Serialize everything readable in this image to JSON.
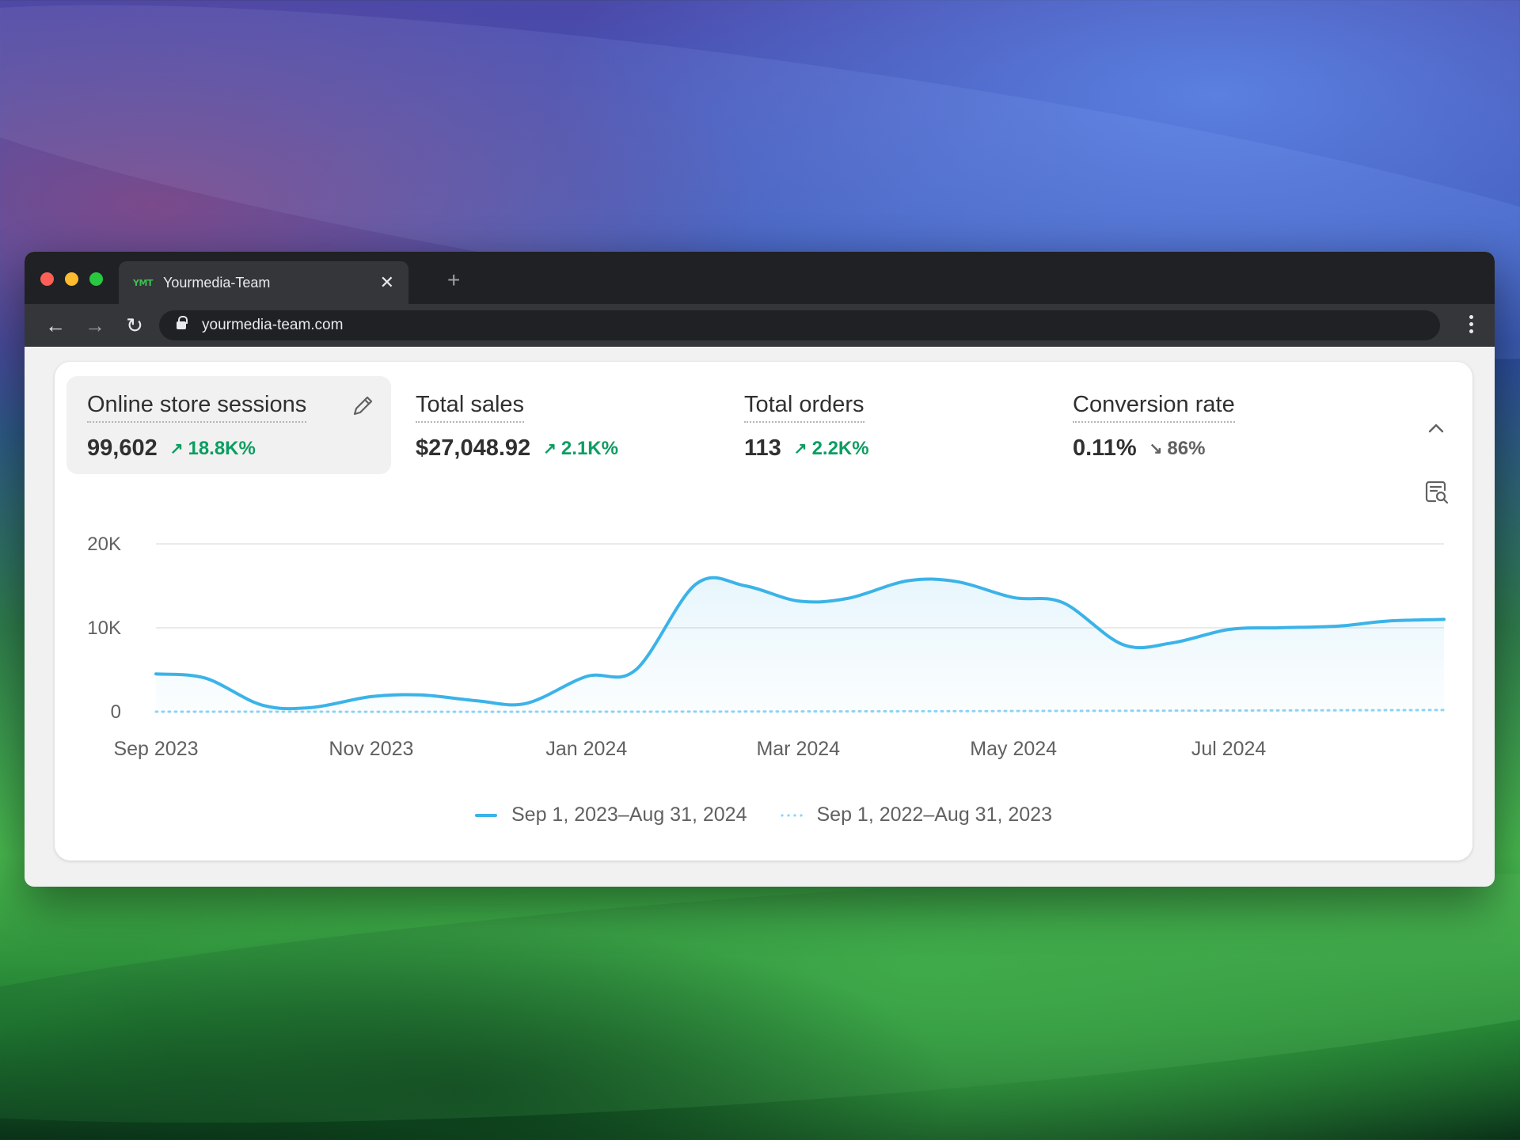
{
  "browser": {
    "tab": {
      "favicon_text": "YMT",
      "title": "Yourmedia-Team"
    },
    "url": "yourmedia-team.com"
  },
  "metrics": [
    {
      "label": "Online store sessions",
      "value": "99,602",
      "change": "18.8K%",
      "direction": "up"
    },
    {
      "label": "Total sales",
      "value": "$27,048.92",
      "change": "2.1K%",
      "direction": "up"
    },
    {
      "label": "Total orders",
      "value": "113",
      "change": "2.2K%",
      "direction": "up"
    },
    {
      "label": "Conversion rate",
      "value": "0.11%",
      "change": "86%",
      "direction": "down"
    }
  ],
  "colors": {
    "accent": "#3bb3e8",
    "positive": "#0c9d61",
    "previous": "#8fd3f4"
  },
  "chart_data": {
    "type": "area",
    "x_tick_labels": [
      "Sep 2023",
      "Nov 2023",
      "Jan 2024",
      "Mar 2024",
      "May 2024",
      "Jul 2024"
    ],
    "y_tick_labels": [
      "0",
      "10K",
      "20K"
    ],
    "ylim": [
      0,
      20000
    ],
    "grid": true,
    "legend_placement": "bottom-center",
    "series": [
      {
        "name": "Sep 1, 2023–Aug 31, 2024",
        "style": "solid",
        "x": [
          "2023-09-01",
          "2023-09-15",
          "2023-10-01",
          "2023-10-15",
          "2023-11-01",
          "2023-11-15",
          "2023-12-01",
          "2023-12-15",
          "2024-01-01",
          "2024-01-15",
          "2024-02-01",
          "2024-02-15",
          "2024-03-01",
          "2024-03-15",
          "2024-04-01",
          "2024-04-15",
          "2024-05-01",
          "2024-05-15",
          "2024-06-01",
          "2024-06-15",
          "2024-07-01",
          "2024-07-15",
          "2024-08-01",
          "2024-08-15",
          "2024-08-31"
        ],
        "values": [
          4500,
          4000,
          800,
          500,
          1800,
          2000,
          1300,
          1000,
          4200,
          5000,
          15200,
          15000,
          13200,
          13500,
          15600,
          15500,
          13600,
          13000,
          8000,
          8200,
          9800,
          10000,
          10200,
          10800,
          11000
        ]
      },
      {
        "name": "Sep 1, 2022–Aug 31, 2023",
        "style": "dotted",
        "x": [
          "2023-09-01",
          "2024-02-01",
          "2024-08-31"
        ],
        "values": [
          0,
          10,
          200
        ]
      }
    ]
  }
}
